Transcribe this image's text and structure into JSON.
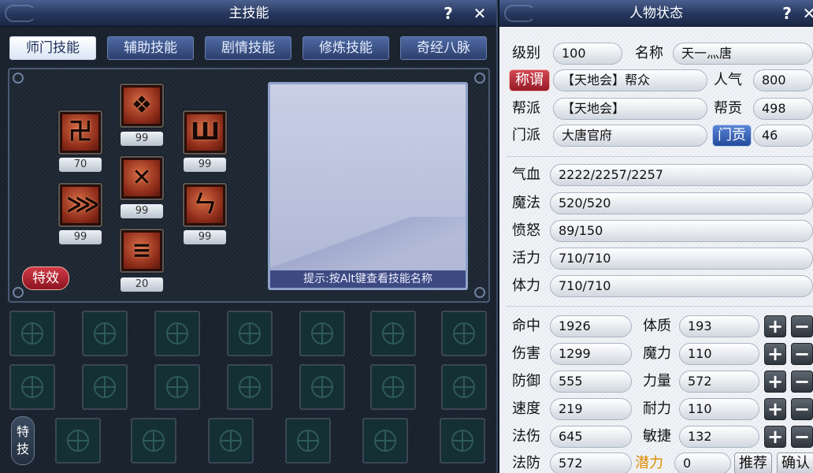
{
  "left_panel": {
    "title": "主技能",
    "help_label": "?",
    "close_label": "✕",
    "tabs": [
      {
        "label": "师门技能",
        "active": true
      },
      {
        "label": "辅助技能",
        "active": false
      },
      {
        "label": "剧情技能",
        "active": false
      },
      {
        "label": "修炼技能",
        "active": false
      },
      {
        "label": "奇经八脉",
        "active": false
      }
    ],
    "skills": [
      {
        "glyph": "卍",
        "level": "70"
      },
      {
        "glyph": "❖",
        "level": "99"
      },
      {
        "glyph": "✕",
        "level": "99"
      },
      {
        "glyph": "≡",
        "level": "20"
      },
      {
        "glyph": "Ш",
        "level": "99"
      },
      {
        "glyph": "ㄣ",
        "level": "99"
      },
      {
        "glyph": "⋙",
        "level": "99"
      }
    ],
    "special_effect_label": "特效",
    "hint_text": "提示:按Alt键查看技能名称",
    "special_skill_label": "特技",
    "icons": {
      "slot": "knot-icon",
      "corner": "swirl-icon"
    }
  },
  "right_panel": {
    "title": "人物状态",
    "help_label": "?",
    "close_label": "✕",
    "level": {
      "label": "级别",
      "value": "100"
    },
    "name": {
      "label": "名称",
      "value": "天一灬唐"
    },
    "title_btn": {
      "label": "称谓",
      "value": "【天地会】帮众"
    },
    "popularity": {
      "label": "人气",
      "value": "800"
    },
    "gang": {
      "label": "帮派",
      "value": "【天地会】"
    },
    "gang_contrib": {
      "label": "帮贡",
      "value": "498"
    },
    "sect": {
      "label": "门派",
      "value": "大唐官府"
    },
    "sect_contrib": {
      "label": "门贡",
      "value": "46"
    },
    "hp": {
      "label": "气血",
      "value": "2222/2257/2257"
    },
    "mp": {
      "label": "魔法",
      "value": "520/520"
    },
    "rage": {
      "label": "愤怒",
      "value": "89/150"
    },
    "vitality": {
      "label": "活力",
      "value": "710/710"
    },
    "stamina": {
      "label": "体力",
      "value": "710/710"
    },
    "stats_left": [
      {
        "label": "命中",
        "value": "1926"
      },
      {
        "label": "伤害",
        "value": "1299"
      },
      {
        "label": "防御",
        "value": "555"
      },
      {
        "label": "速度",
        "value": "219"
      },
      {
        "label": "法伤",
        "value": "645"
      },
      {
        "label": "法防",
        "value": "572"
      }
    ],
    "stats_right": [
      {
        "label": "体质",
        "value": "193"
      },
      {
        "label": "魔力",
        "value": "110"
      },
      {
        "label": "力量",
        "value": "572"
      },
      {
        "label": "耐力",
        "value": "110"
      },
      {
        "label": "敏捷",
        "value": "132"
      }
    ],
    "plus_label": "+",
    "minus_label": "−",
    "potential": {
      "label": "潜力",
      "value": "0"
    },
    "recommend_label": "推荐",
    "confirm_label": "确认",
    "colors": {
      "potential": "#e08a00",
      "title_bar": "#26365c"
    }
  }
}
